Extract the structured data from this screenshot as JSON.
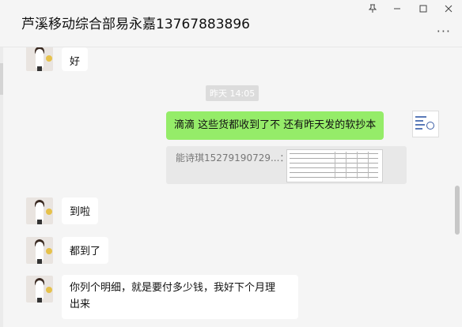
{
  "window": {
    "title": "芦溪移动综合部易永嘉13767883896",
    "pin_icon": "pin-icon",
    "minimize_icon": "minimize-icon",
    "maximize_icon": "maximize-icon",
    "close_icon": "close-icon",
    "more_label": "···"
  },
  "messages": {
    "m1": "好",
    "time_label": "昨天 14:05",
    "m2": "滴滴 这些货都收到了不  还有昨天发的软抄本",
    "quote": "能诗琪15279190729...：",
    "m3": "到啦",
    "m4": "都到了",
    "m5_line1": "你列个明细，就是要付多少钱，我好下个月理",
    "m5_line2": "出来"
  }
}
